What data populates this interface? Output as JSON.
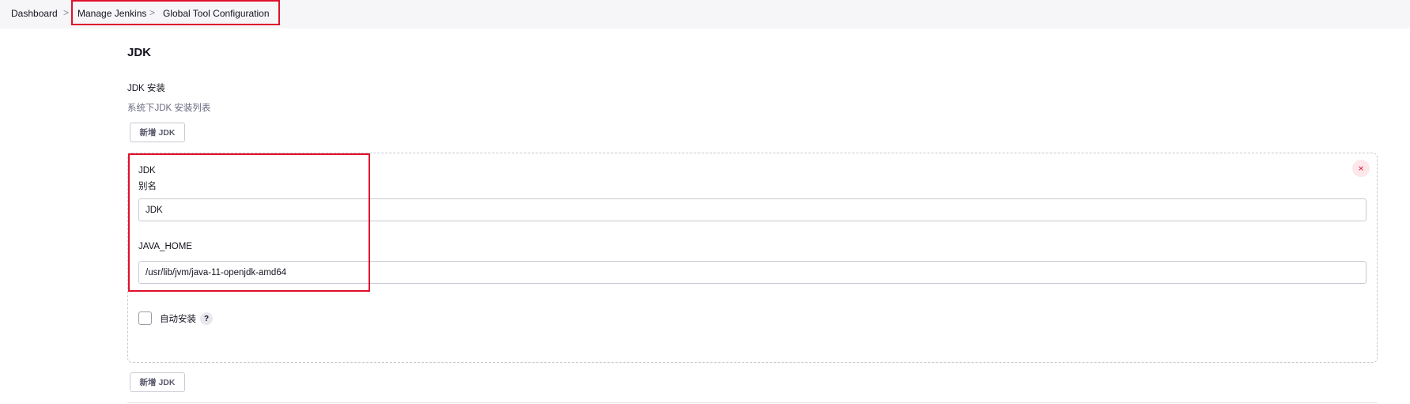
{
  "breadcrumb": {
    "items": [
      {
        "label": "Dashboard"
      },
      {
        "label": "Manage Jenkins"
      },
      {
        "label": "Global Tool Configuration"
      }
    ],
    "separator": ">"
  },
  "section": {
    "title": "JDK",
    "install_label": "JDK 安装",
    "install_desc": "系统下JDK 安装列表",
    "add_button_label": "新增 JDK"
  },
  "jdk_entry": {
    "header_label": "JDK",
    "name_label": "别名",
    "name_value": "JDK",
    "java_home_label": "JAVA_HOME",
    "java_home_value": "/usr/lib/jvm/java-11-openjdk-amd64",
    "auto_install_label": "自动安装",
    "auto_install_checked": false,
    "help_glyph": "?",
    "close_glyph": "×",
    "close_icon": "close-icon",
    "help_icon": "help-icon"
  },
  "colors": {
    "highlight": "#e0102b",
    "breadcrumb_bg": "#f6f6f8",
    "close_bg": "#fde7ea"
  }
}
